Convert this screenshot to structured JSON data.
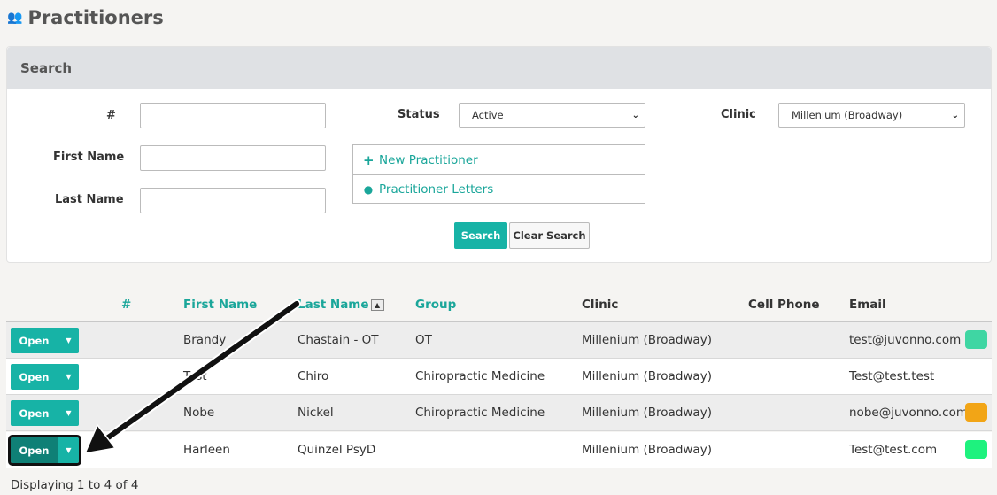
{
  "page": {
    "title": "Practitioners",
    "title_icon": "users-icon"
  },
  "search": {
    "header": "Search",
    "number_label": "#",
    "number_value": "",
    "first_name_label": "First Name",
    "first_name_value": "",
    "last_name_label": "Last Name",
    "last_name_value": "",
    "status_label": "Status",
    "status_value": "Active",
    "clinic_label": "Clinic",
    "clinic_value": "Millenium (Broadway)",
    "links": {
      "new_practitioner": "New Practitioner",
      "practitioner_letters": "Practitioner Letters"
    },
    "search_button": "Search",
    "clear_button": "Clear Search"
  },
  "table": {
    "columns": {
      "number": "#",
      "first_name": "First Name",
      "last_name": "Last Name",
      "group": "Group",
      "clinic": "Clinic",
      "cell_phone": "Cell Phone",
      "email": "Email"
    },
    "open_label": "Open",
    "rows": [
      {
        "first_name": "Brandy",
        "last_name": "Chastain - OT",
        "group": "OT",
        "clinic": "Millenium (Broadway)",
        "cell_phone": "",
        "email": "test@juvonno.com",
        "color": "#3fd6a3"
      },
      {
        "first_name": "Test",
        "last_name": "Chiro",
        "group": "Chiropractic Medicine",
        "clinic": "Millenium (Broadway)",
        "cell_phone": "",
        "email": "Test@test.test",
        "color": "#ffffff"
      },
      {
        "first_name": "Nobe",
        "last_name": "Nickel",
        "group": "Chiropractic Medicine",
        "clinic": "Millenium (Broadway)",
        "cell_phone": "",
        "email": "nobe@juvonno.com",
        "color": "#f2a516"
      },
      {
        "first_name": "Harleen",
        "last_name": "Quinzel PsyD",
        "group": "",
        "clinic": "Millenium (Broadway)",
        "cell_phone": "",
        "email": "Test@test.com",
        "color": "#1ef27e"
      }
    ],
    "footer": "Displaying 1 to 4 of 4"
  },
  "colors": {
    "accent": "#17b3a6",
    "link": "#1aa69a"
  }
}
